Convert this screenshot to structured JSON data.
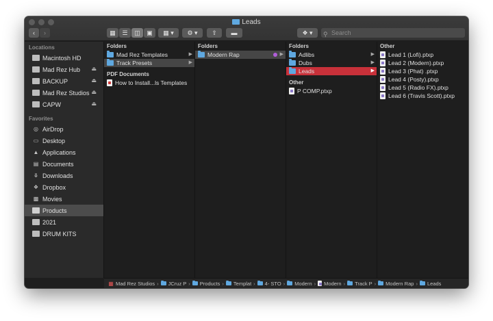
{
  "window": {
    "title": "Leads"
  },
  "toolbar": {
    "back_icon": "chevron-left-icon",
    "forward_icon": "chevron-right-icon",
    "view_icons": [
      "icon-view-icon",
      "list-view-icon",
      "column-view-icon",
      "gallery-view-icon"
    ],
    "active_view": "column-view-icon",
    "group_icon": "grid-icon",
    "action_icon": "gear-icon",
    "share_icon": "share-icon",
    "tag_icon": "tag-icon",
    "dropbox_icon": "dropbox-icon",
    "search_placeholder": "Search"
  },
  "sidebar": {
    "locations_header": "Locations",
    "locations": [
      {
        "label": "Macintosh HD",
        "icon": "disk-icon",
        "eject": false
      },
      {
        "label": "Mad Rez Hub",
        "icon": "disk-icon",
        "eject": true
      },
      {
        "label": "BACKUP",
        "icon": "disk-icon",
        "eject": true
      },
      {
        "label": "Mad Rez Studios",
        "icon": "disk-icon",
        "eject": true
      },
      {
        "label": "CAPW",
        "icon": "disk-icon",
        "eject": true
      }
    ],
    "favorites_header": "Favorites",
    "favorites": [
      {
        "label": "AirDrop",
        "icon": "airdrop-icon"
      },
      {
        "label": "Desktop",
        "icon": "desktop-icon"
      },
      {
        "label": "Applications",
        "icon": "applications-icon"
      },
      {
        "label": "Documents",
        "icon": "document-icon"
      },
      {
        "label": "Downloads",
        "icon": "download-icon"
      },
      {
        "label": "Dropbox",
        "icon": "dropbox-icon"
      },
      {
        "label": "Movies",
        "icon": "movies-icon"
      },
      {
        "label": "Products",
        "icon": "folder-icon",
        "selected": true
      },
      {
        "label": "2021",
        "icon": "folder-icon"
      },
      {
        "label": "DRUM KITS",
        "icon": "folder-icon"
      }
    ]
  },
  "columns": {
    "col1": {
      "header": "Folders",
      "items": [
        "Mad Rez Templates",
        "Track Presets"
      ],
      "selected": "Track Presets",
      "pdf_header": "PDF Documents",
      "pdf_items": [
        "How to Install...ls Templates"
      ]
    },
    "col2": {
      "header": "Folders",
      "items": [
        "Modern Rap"
      ],
      "selected": "Modern Rap",
      "tag_color": "#b05ed8"
    },
    "col3": {
      "header": "Folders",
      "items": [
        "Adlibs",
        "Dubs",
        "Leads"
      ],
      "selected": "Leads",
      "other_header": "Other",
      "other_items": [
        "P COMP.ptxp"
      ]
    },
    "col4": {
      "header": "Other",
      "items": [
        "Lead 1 (Lofi).ptxp",
        "Lead 2 (Modern).ptxp",
        "Lead 3 (Phat) .ptxp",
        "Lead 4 (Posty).ptxp",
        "Lead 5 (Radio FX).ptxp",
        "Lead 6 (Travis Scott).ptxp"
      ]
    }
  },
  "pathbar": [
    "Mad Rez Studios",
    "JCruz P",
    "Products",
    "Templat",
    "4- STO",
    "Modern",
    "Modern",
    "Track P",
    "Modern Rap",
    "Leads"
  ],
  "colors": {
    "selection_red": "#c8313a",
    "folder_blue": "#5fa8e0"
  }
}
